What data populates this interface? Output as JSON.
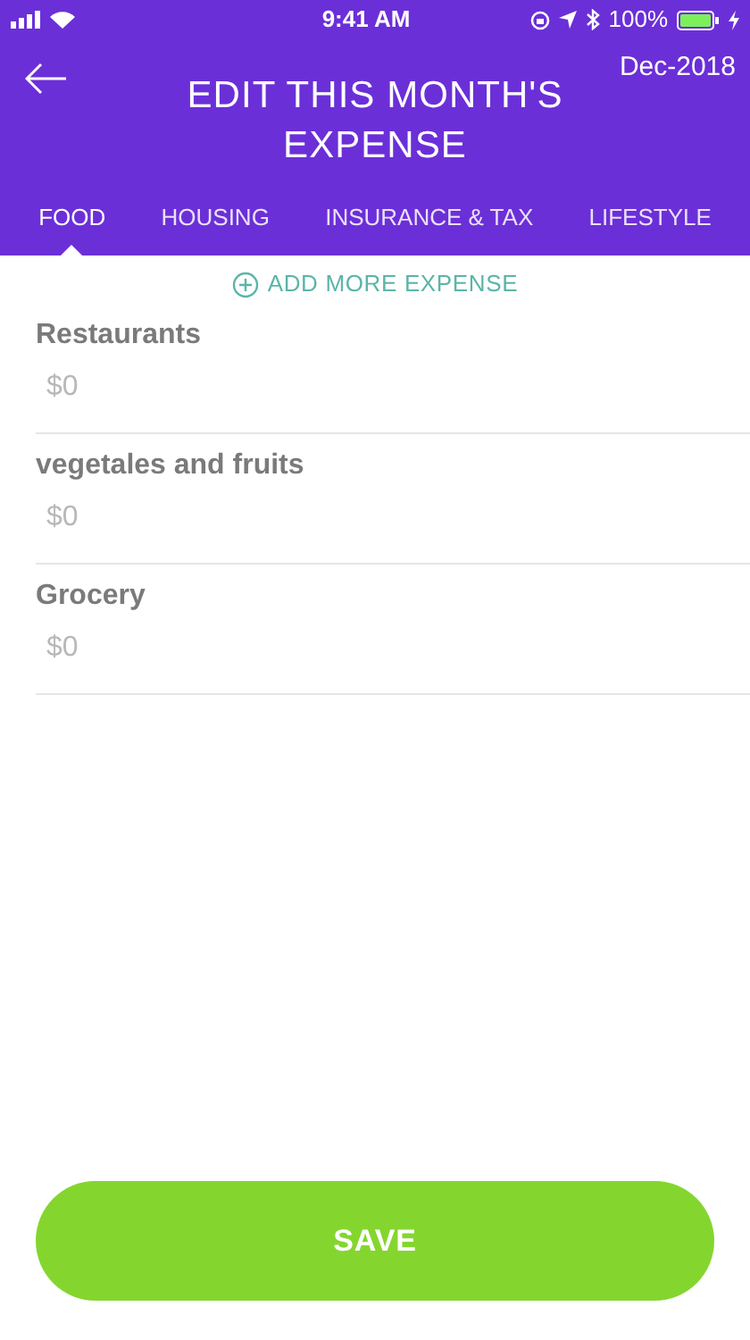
{
  "status_bar": {
    "time": "9:41 AM",
    "battery": "100%"
  },
  "header": {
    "title": "EDIT THIS MONTH'S EXPENSE",
    "date": "Dec-2018"
  },
  "tabs": [
    {
      "label": "FOOD",
      "selected": true
    },
    {
      "label": "HOUSING",
      "selected": false
    },
    {
      "label": "INSURANCE & TAX",
      "selected": false
    },
    {
      "label": "LIFESTYLE",
      "selected": false
    }
  ],
  "add_button": "ADD MORE EXPENSE",
  "expenses": [
    {
      "label": "Restaurants",
      "placeholder": "$0"
    },
    {
      "label": "vegetales and fruits",
      "placeholder": "$0"
    },
    {
      "label": "Grocery",
      "placeholder": "$0"
    }
  ],
  "save_button": "SAVE"
}
